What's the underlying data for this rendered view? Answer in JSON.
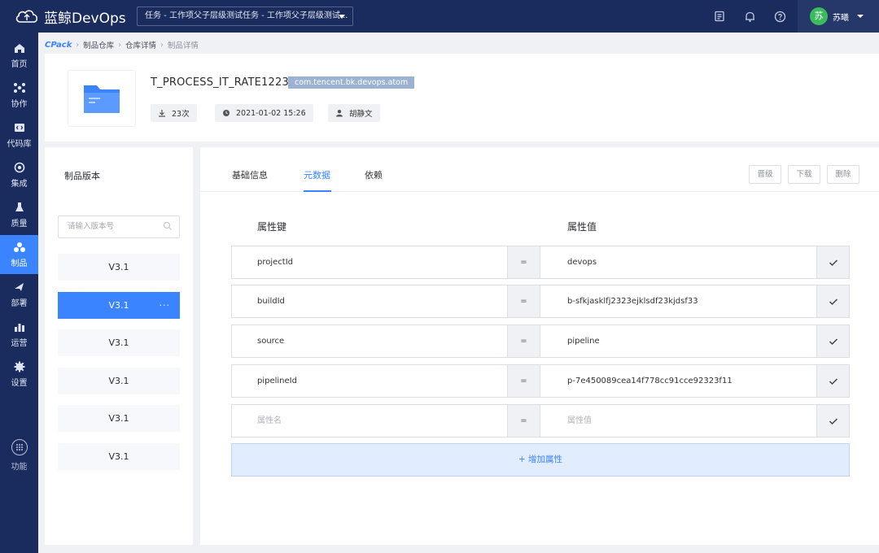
{
  "app": {
    "name": "蓝鲸DevOps"
  },
  "task_selector": {
    "value": "任务 - 工作项父子层级测试任务 - 工作项父子层级测试..."
  },
  "topbar": {
    "icons": [
      "doc-icon",
      "bell-icon",
      "help-icon"
    ]
  },
  "user": {
    "avatar_char": "苏",
    "name": "苏曦"
  },
  "sidebar": {
    "items": [
      {
        "label": "首页",
        "icon": "home-icon"
      },
      {
        "label": "协作",
        "icon": "collab-icon"
      },
      {
        "label": "代码库",
        "icon": "code-icon"
      },
      {
        "label": "集成",
        "icon": "integration-icon"
      },
      {
        "label": "质量",
        "icon": "quality-icon"
      },
      {
        "label": "制品",
        "icon": "artifact-icon",
        "active": true
      },
      {
        "label": "部署",
        "icon": "deploy-icon"
      },
      {
        "label": "运营",
        "icon": "ops-icon"
      },
      {
        "label": "设置",
        "icon": "settings-icon"
      }
    ],
    "bottom_label": "功能"
  },
  "breadcrumb": {
    "root": "CPack",
    "items": [
      "制品仓库",
      "仓库详情",
      "制品详情"
    ]
  },
  "artifact": {
    "name": "T_PROCESS_IT_RATE1223",
    "tag": "com.tencent.bk.devops.atom",
    "downloads": "23次",
    "date": "2021-01-02 15:26",
    "author": "胡静文"
  },
  "versions": {
    "title": "制品版本",
    "search_placeholder": "请输入版本号",
    "items": [
      "V3.1",
      "V3.1",
      "V3.1",
      "V3.1",
      "V3.1",
      "V3.1"
    ],
    "active_index": 1,
    "more_label": "···"
  },
  "tabs": [
    "基础信息",
    "元数据",
    "依赖"
  ],
  "active_tab": "元数据",
  "actions": {
    "promote": "晋级",
    "download": "下载",
    "delete": "删除"
  },
  "metadata": {
    "key_header": "属性键",
    "value_header": "属性值",
    "equals": "=",
    "rows": [
      {
        "key": "projectId",
        "value": "devops"
      },
      {
        "key": "buildId",
        "value": "b-sfkjasklfj2323ejklsdf23kjdsf33"
      },
      {
        "key": "source",
        "value": "pipeline"
      },
      {
        "key": "pipelineId",
        "value": "p-7e450089cea14f778cc91cce92323f11"
      }
    ],
    "new_row": {
      "key_placeholder": "属性名",
      "value_placeholder": "属性值"
    },
    "add_label": "+ 增加属性"
  },
  "colors": {
    "navy": "#1a2b5e",
    "accent": "#3a84ff",
    "tag_bg": "#9bb2d2"
  }
}
